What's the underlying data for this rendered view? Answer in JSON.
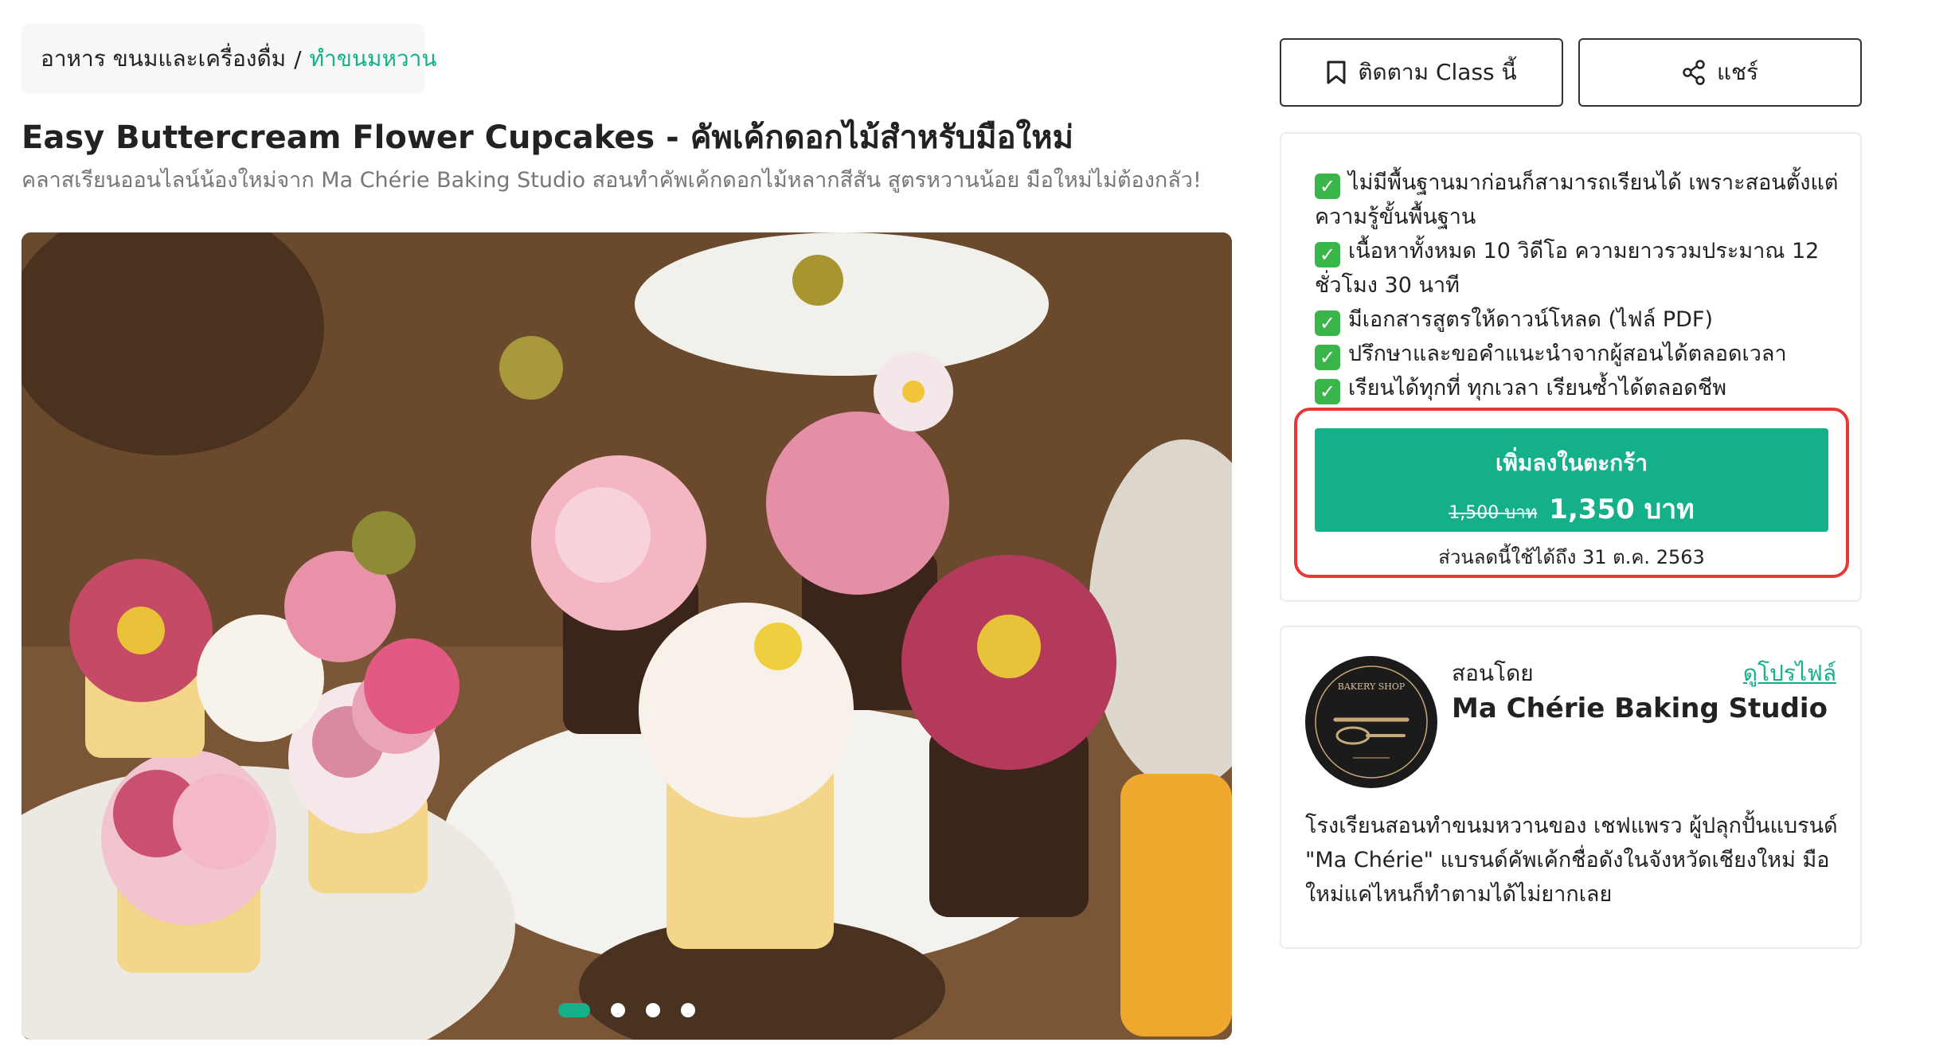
{
  "breadcrumb": {
    "category": "อาหาร ขนมและเครื่องดื่ม",
    "separator": "/",
    "current": "ทำขนมหวาน"
  },
  "course": {
    "title": "Easy Buttercream Flower Cupcakes - คัพเค้กดอกไม้สำหรับมือใหม่",
    "subtitle": "คลาสเรียนออนไลน์น้องใหม่จาก Ma Chérie Baking Studio สอนทำคัพเค้กดอกไม้หลากสีสัน สูตรหวานน้อย มือใหม่ไม่ต้องกลัว!"
  },
  "carousel": {
    "slides": 4,
    "active_index": 0
  },
  "actions": {
    "follow_label": "ติดตาม Class นี้",
    "share_label": "แชร์"
  },
  "features": [
    "ไม่มีพื้นฐานมาก่อนก็สามารถเรียนได้ เพราะสอนตั้งแต่ความรู้ขั้นพื้นฐาน",
    "เนื้อหาทั้งหมด 10 วิดีโอ ความยาวรวมประมาณ 12 ชั่วโมง 30 นาที",
    "มีเอกสารสูตรให้ดาวน์โหลด (ไฟล์ PDF)",
    "ปรึกษาและขอคำแนะนำจากผู้สอนได้ตลอดเวลา",
    "เรียนได้ทุกที่ ทุกเวลา เรียนซ้ำได้ตลอดชีพ"
  ],
  "purchase": {
    "button_label": "เพิ่มลงในตะกร้า",
    "original_price": "1,500 บาท",
    "sale_price": "1,350 บาท",
    "discount_note": "ส่วนลดนี้ใช้ได้ถึง 31 ต.ค. 2563"
  },
  "teacher": {
    "taught_by_label": "สอนโดย",
    "view_profile_label": "ดูโปรไฟล์",
    "name": "Ma Chérie Baking Studio",
    "description": "โรงเรียนสอนทำขนมหวานของ เชฟแพรว ผู้ปลุกปั้นแบรนด์ \"Ma Chérie\" แบรนด์คัพเค้กชื่อดังในจังหวัดเชียงใหม่ มือใหม่แค่ไหนก็ทำตามได้ไม่ยากเลย",
    "logo_text": "BAKERY SHOP"
  },
  "colors": {
    "accent": "#14b08a",
    "highlight_border": "#e53935",
    "check": "#3ab54a"
  },
  "icons": {
    "follow": "bookmark-icon",
    "share": "share-icon",
    "feature": "check-box-icon"
  }
}
